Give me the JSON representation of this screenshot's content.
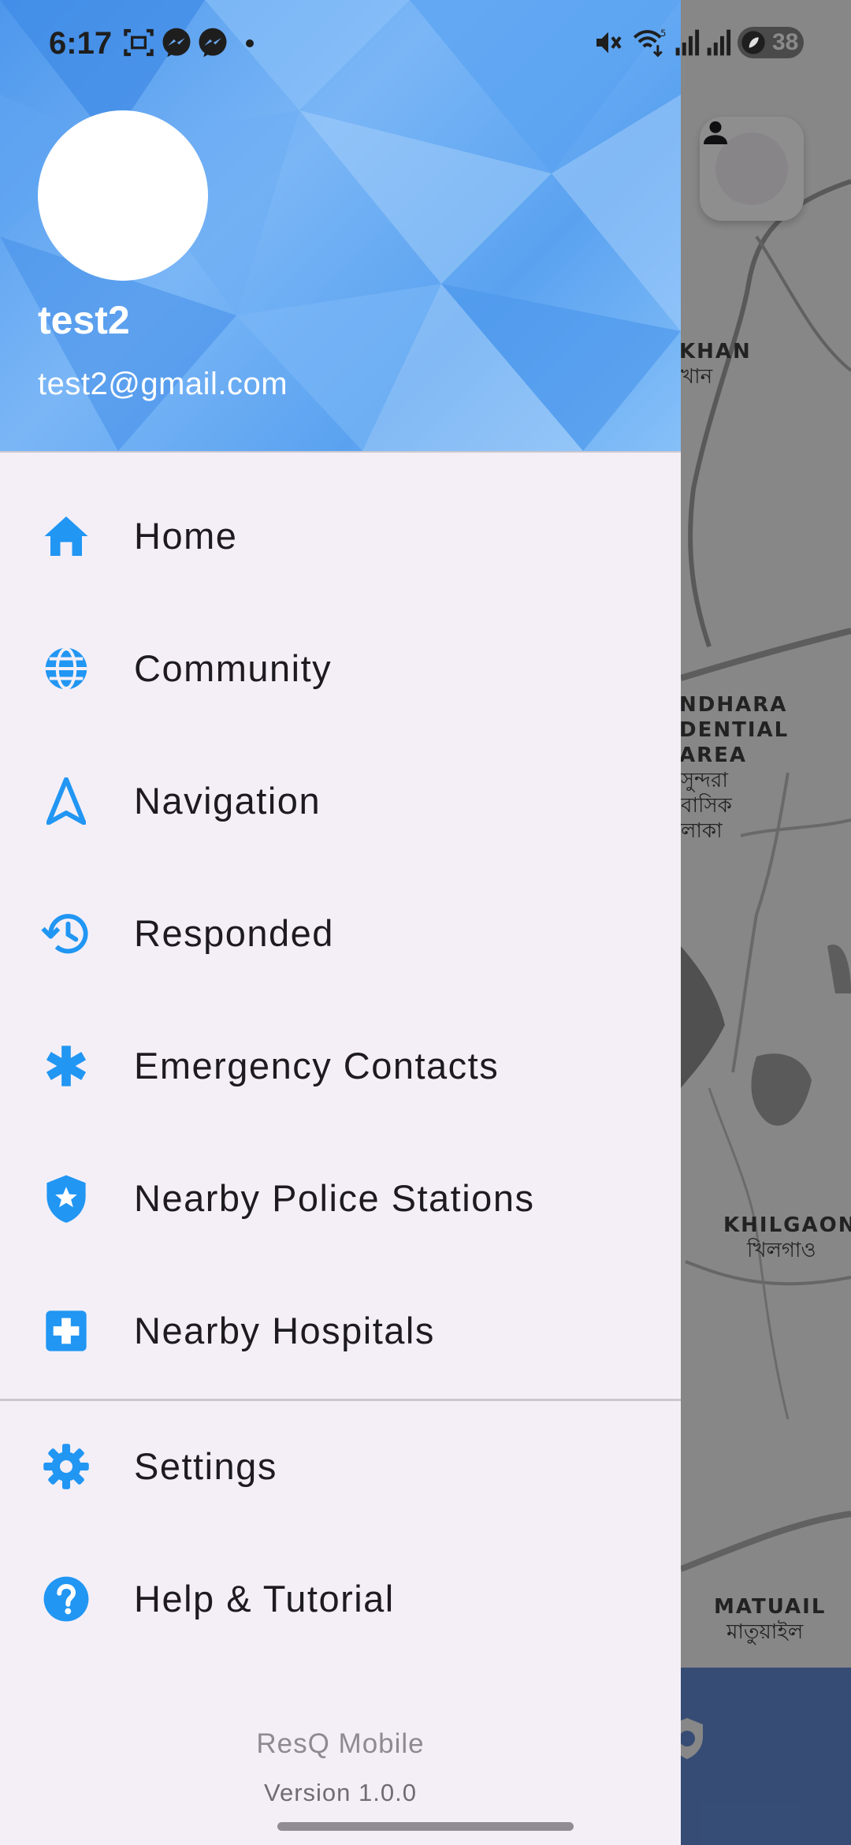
{
  "status_bar": {
    "time": "6:17",
    "battery": "38",
    "icons": [
      "screenshot-icon",
      "messenger-icon",
      "messenger-icon",
      "dot-icon",
      "mute-icon",
      "wifi-icon",
      "signal-icon",
      "signal-icon",
      "battery-icon"
    ]
  },
  "drawer": {
    "header": {
      "user_name": "test2",
      "user_email": "test2@gmail.com"
    },
    "items": [
      {
        "label": "Home",
        "icon": "home-icon"
      },
      {
        "label": "Community",
        "icon": "globe-icon"
      },
      {
        "label": "Navigation",
        "icon": "navigation-icon"
      },
      {
        "label": "Responded",
        "icon": "history-icon"
      },
      {
        "label": "Emergency Contacts",
        "icon": "asterisk-icon"
      },
      {
        "label": "Nearby Police Stations",
        "icon": "police-shield-icon"
      },
      {
        "label": "Nearby Hospitals",
        "icon": "hospital-icon"
      }
    ],
    "secondary_items": [
      {
        "label": "Settings",
        "icon": "gear-icon"
      },
      {
        "label": "Help & Tutorial",
        "icon": "help-icon"
      }
    ],
    "footer": {
      "app_name": "ResQ Mobile",
      "version": "Version 1.0.0"
    },
    "accent_color": "#2196f3"
  },
  "map": {
    "labels": [
      {
        "text": "KHAN"
      },
      {
        "text": "খান"
      },
      {
        "text": "NDHARA\nDENTIAL\nAREA"
      },
      {
        "text": "সুন্দরা\nবাসিক\nলাকা"
      },
      {
        "text": "KHILGAON"
      },
      {
        "text": "খিলগাও"
      },
      {
        "text": "MATUAIL"
      },
      {
        "text": "মাতুয়াইল"
      }
    ]
  }
}
